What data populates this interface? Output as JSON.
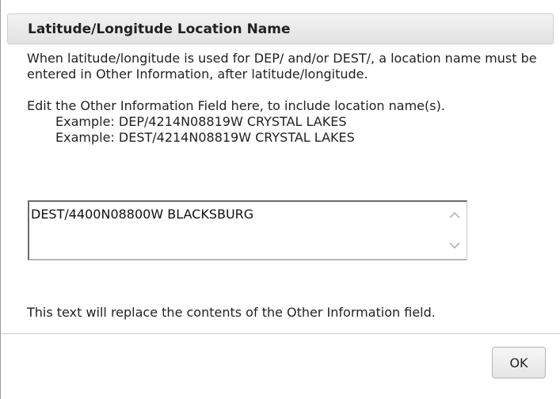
{
  "dialog": {
    "title": "Latitude/Longitude Location Name",
    "instruction_1": "When latitude/longitude is used for DEP/ and/or DEST/, a location name must be entered in Other Information, after latitude/longitude.",
    "instruction_2": "Edit the Other Information Field here, to include location name(s).",
    "example_1": "Example: DEP/4214N08819W CRYSTAL LAKES",
    "example_2": "Example: DEST/4214N08819W CRYSTAL LAKES",
    "other_information_value": "DEST/4400N08800W BLACKSBURG",
    "footer_note": "This text will replace the contents of the Other Information field.",
    "ok_label": "OK"
  },
  "icons": {
    "scroll_up": "chevron-up-icon",
    "scroll_down": "chevron-down-icon"
  },
  "colors": {
    "title_bar": "#e9e9e9",
    "text": "#222222",
    "chevron": "#a9b8c8"
  }
}
